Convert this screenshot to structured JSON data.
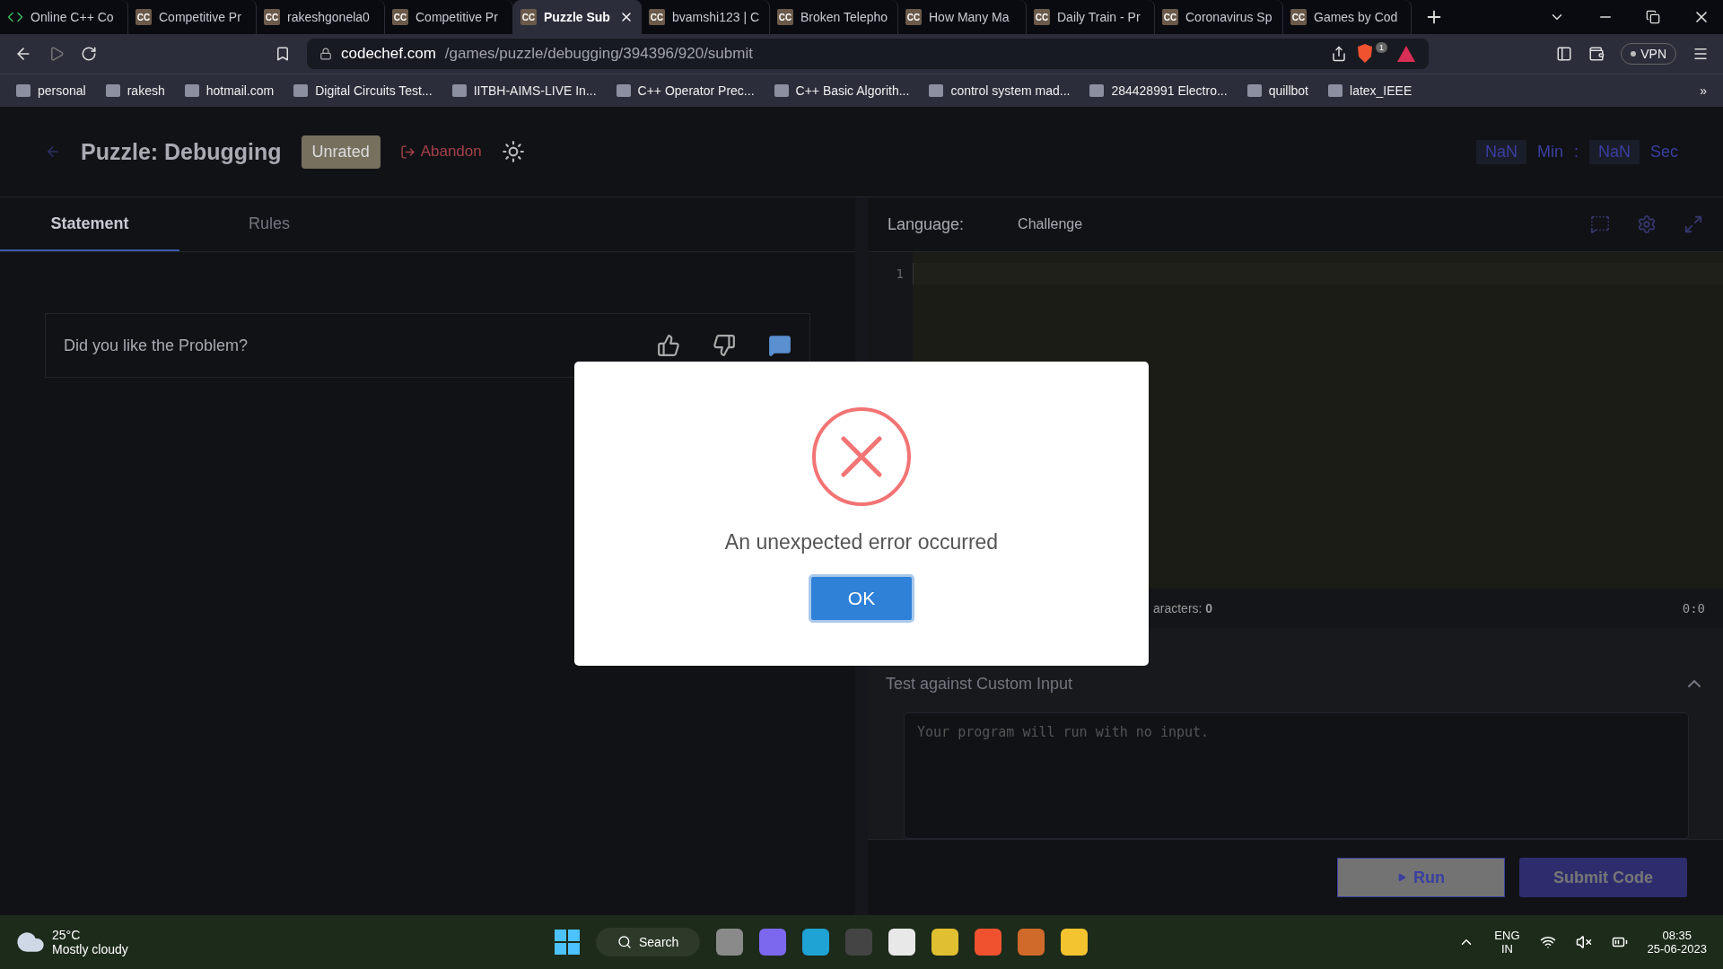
{
  "browser": {
    "tabs": [
      {
        "label": "Online C++ Co",
        "kind": "code",
        "selected": false
      },
      {
        "label": "Competitive Pr",
        "kind": "cc",
        "favicon": "CC",
        "selected": false
      },
      {
        "label": "rakeshgonela0",
        "kind": "cc",
        "favicon": "CC",
        "selected": false
      },
      {
        "label": "Competitive Pr",
        "kind": "cc",
        "favicon": "CC",
        "selected": false
      },
      {
        "label": "Puzzle Sub",
        "kind": "cc",
        "favicon": "CC",
        "selected": true
      },
      {
        "label": "bvamshi123 | C",
        "kind": "cc",
        "favicon": "CC",
        "selected": false
      },
      {
        "label": "Broken Telepho",
        "kind": "cc",
        "favicon": "CC",
        "selected": false
      },
      {
        "label": "How Many Ma",
        "kind": "cc",
        "favicon": "CC",
        "selected": false
      },
      {
        "label": "Daily Train - Pr",
        "kind": "cc",
        "favicon": "CC",
        "selected": false
      },
      {
        "label": "Coronavirus Sp",
        "kind": "cc",
        "favicon": "CC",
        "selected": false
      },
      {
        "label": "Games by Cod",
        "kind": "cc",
        "favicon": "CC",
        "selected": false
      }
    ],
    "address": {
      "domain": "codechef.com",
      "path": "/games/puzzle/debugging/394396/920/submit"
    },
    "shield_count": "1",
    "vpn": "VPN",
    "bookmarks": [
      "personal",
      "rakesh",
      "hotmail.com",
      "Digital Circuits Test...",
      "IITBH-AIMS-LIVE In...",
      "C++ Operator Prec...",
      "C++ Basic Algorith...",
      "control system mad...",
      "284428991 Electro...",
      "quillbot",
      "latex_IEEE"
    ],
    "more": "»"
  },
  "app": {
    "title": "Puzzle: Debugging",
    "badge": "Unrated",
    "abandon": "Abandon",
    "timer": {
      "minutes": "NaN",
      "min_label": "Min",
      "separator": ":",
      "seconds": "NaN",
      "sec_label": "Sec"
    },
    "panel_tabs": [
      {
        "label": "Statement",
        "selected": true
      },
      {
        "label": "Rules",
        "selected": false
      }
    ],
    "feedback": {
      "question": "Did you like the Problem?"
    },
    "editor": {
      "language_label": "Language:",
      "language": "Challenge",
      "line_numbers": [
        "1"
      ],
      "status": "aracters: **0**",
      "cursor": "0:0"
    },
    "custom_input": {
      "title": "Test against Custom Input",
      "placeholder": "Your program will run with no input."
    },
    "run": "Run",
    "submit": "Submit Code"
  },
  "dialog": {
    "message": "An unexpected error occurred",
    "ok": "OK"
  },
  "taskbar": {
    "temperature": "25°C",
    "weather": "Mostly cloudy",
    "search": "Search",
    "language": "ENG",
    "region": "IN",
    "time": "08:35",
    "date": "25-06-2023"
  }
}
